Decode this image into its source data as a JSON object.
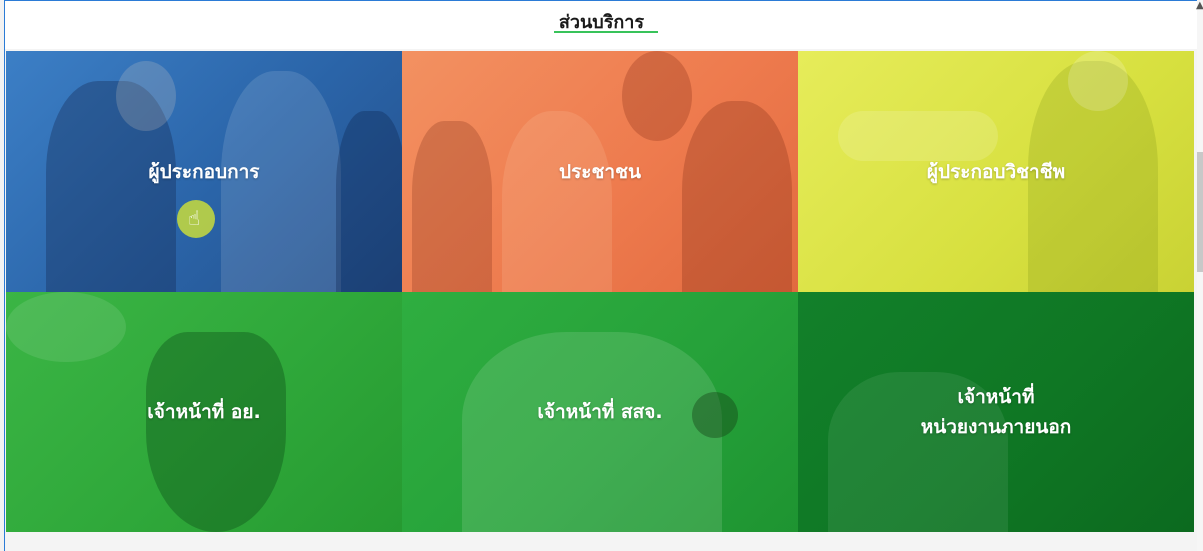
{
  "section": {
    "title": "ส่วนบริการ"
  },
  "tiles": [
    {
      "label": "ผู้ประกอบการ",
      "color": "#2a6bb3"
    },
    {
      "label": "ประชาชน",
      "color": "#f07c4d"
    },
    {
      "label": "ผู้ประกอบวิชาชีพ",
      "color": "#d8e23d"
    },
    {
      "label": "เจ้าหน้าที่ อย.",
      "color": "#2fa93a"
    },
    {
      "label": "เจ้าหน้าที่ สสจ.",
      "color": "#26a33b"
    },
    {
      "label": "เจ้าหน้าที่\nหน่วยงานภายนอก",
      "color": "#0f7a22"
    }
  ]
}
